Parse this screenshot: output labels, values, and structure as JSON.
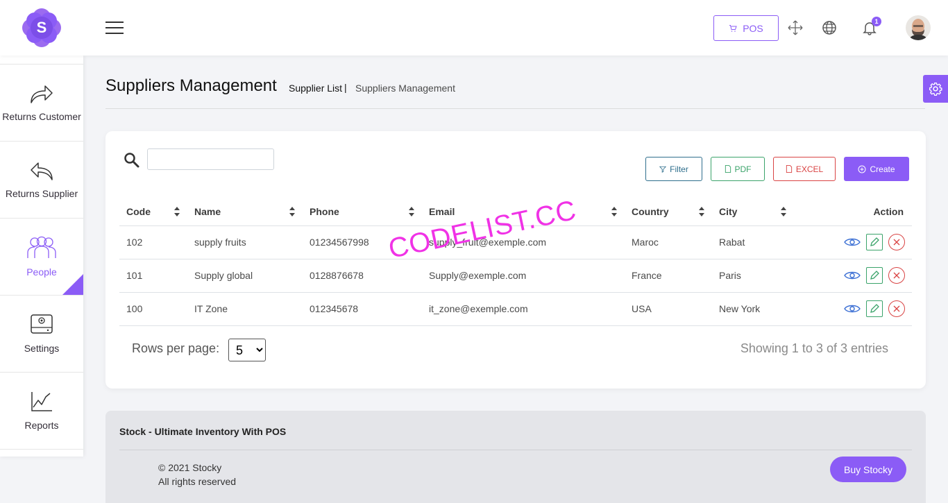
{
  "brand": {
    "logo_letter": "S",
    "accent_color": "#8b5cf6"
  },
  "header": {
    "pos_label": "POS",
    "notification_count": "1"
  },
  "sidebar": {
    "items": [
      {
        "label": "Returns Customer",
        "icon": "returns-customer-icon",
        "active": false
      },
      {
        "label": "Returns Supplier",
        "icon": "returns-supplier-icon",
        "active": false
      },
      {
        "label": "People",
        "icon": "people-icon",
        "active": true
      },
      {
        "label": "Settings",
        "icon": "settings-icon",
        "active": false
      },
      {
        "label": "Reports",
        "icon": "reports-icon",
        "active": false
      }
    ]
  },
  "breadcrumb": {
    "title": "Suppliers Management",
    "current": "Supplier List",
    "separator": "|",
    "parent": "Suppliers Management"
  },
  "toolbar": {
    "search_placeholder": "",
    "filter_label": "Filter",
    "pdf_label": "PDF",
    "excel_label": "EXCEL",
    "create_label": "Create"
  },
  "table": {
    "columns": [
      "Code",
      "Name",
      "Phone",
      "Email",
      "Country",
      "City",
      "Action"
    ],
    "rows": [
      {
        "code": "102",
        "name": "supply fruits",
        "phone": "01234567998",
        "email": "supply_fruit@exemple.com",
        "country": "Maroc",
        "city": "Rabat"
      },
      {
        "code": "101",
        "name": "Supply global",
        "phone": "0128876678",
        "email": "Supply@exemple.com",
        "country": "France",
        "city": "Paris"
      },
      {
        "code": "100",
        "name": "IT Zone",
        "phone": "012345678",
        "email": "it_zone@exemple.com",
        "country": "USA",
        "city": "New York"
      }
    ]
  },
  "pagination": {
    "rows_per_page_label": "Rows per page:",
    "rows_per_page_value": "5",
    "showing_text": "Showing 1 to 3 of 3 entries"
  },
  "watermark": "CODELIST.CC",
  "footer": {
    "title": "Stock - Ultimate Inventory With POS",
    "copyright": "© 2021 Stocky",
    "rights": "All rights reserved",
    "buy_label": "Buy Stocky"
  }
}
